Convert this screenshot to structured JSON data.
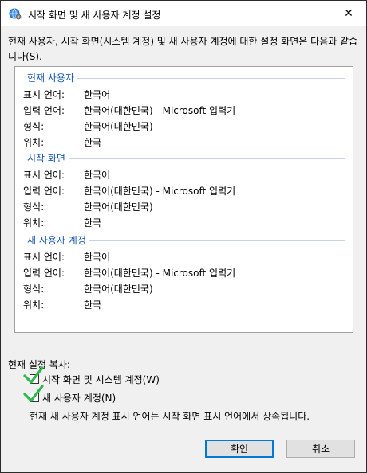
{
  "window": {
    "title": "시작 화면 및 새 사용자 계정 설정",
    "icon": "globe-settings-icon",
    "close_glyph": "✕"
  },
  "intro": "현재 사용자, 시작 화면(시스템 계정) 및 새 사용자 계정에 대한 설정 화면은 다음과 같습니다(S).",
  "labels": {
    "display_language": "표시 언어:",
    "input_language": "입력 언어:",
    "format": "형식:",
    "location": "위치:"
  },
  "sections": [
    {
      "title": "현재 사용자",
      "display_language": "한국어",
      "input_language": "한국어(대한민국) - Microsoft 입력기",
      "format": "한국어(대한민국)",
      "location": "한국"
    },
    {
      "title": "시작 화면",
      "display_language": "한국어",
      "input_language": "한국어(대한민국) - Microsoft 입력기",
      "format": "한국어(대한민국)",
      "location": "한국"
    },
    {
      "title": "새 사용자 계정",
      "display_language": "한국어",
      "input_language": "한국어(대한민국) - Microsoft 입력기",
      "format": "한국어(대한민국)",
      "location": "한국"
    }
  ],
  "copy": {
    "label": "현재 설정 복사:",
    "option_welcome": {
      "label": "시작 화면 및 시스템 계정(W)",
      "checked": true
    },
    "option_new_user": {
      "label": "새 사용자 계정(N)",
      "checked": true
    },
    "note": "현재 새 사용자 계정 표시 언어는 시작 화면 표시 언어에서 상속됩니다."
  },
  "buttons": {
    "ok": "확인",
    "cancel": "취소"
  },
  "colors": {
    "section_title": "#1a58ab",
    "checkmark": "#2db84a",
    "primary_border": "#0078d7"
  }
}
